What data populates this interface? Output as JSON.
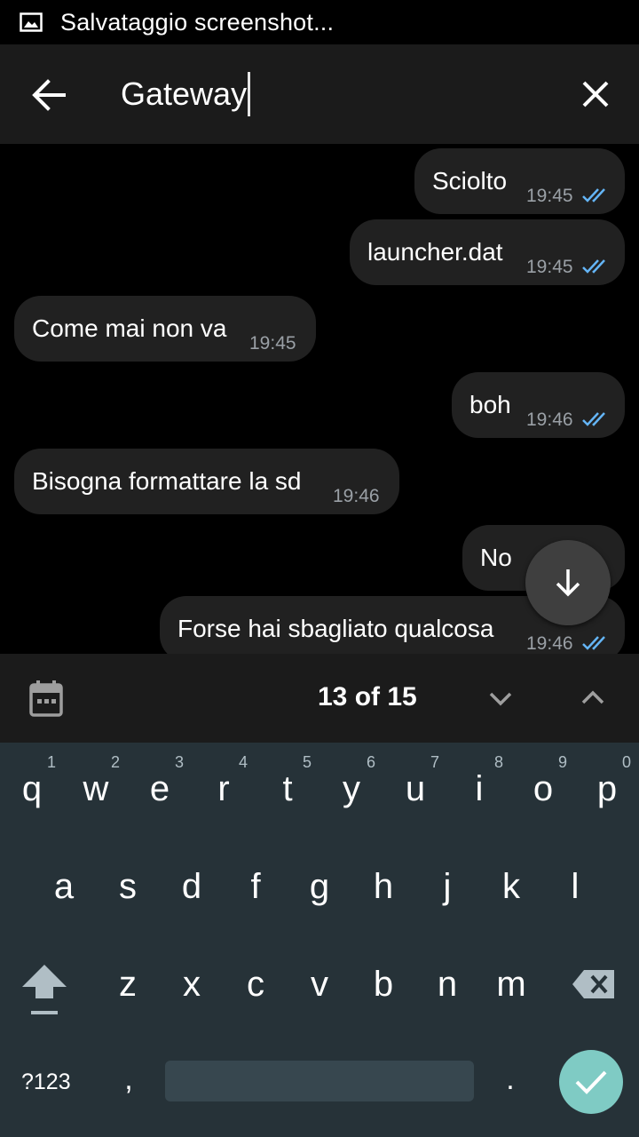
{
  "status_bar": {
    "text": "Salvataggio screenshot..."
  },
  "search": {
    "query": "Gateway"
  },
  "messages": [
    {
      "text": "Sciolto",
      "time": "19:45",
      "outgoing": true
    },
    {
      "text": "launcher.dat",
      "time": "19:45",
      "outgoing": true
    },
    {
      "text": "Come mai non va",
      "time": "19:45",
      "outgoing": false
    },
    {
      "text": "boh",
      "time": "19:46",
      "outgoing": true
    },
    {
      "text": "Bisogna formattare la sd",
      "time": "19:46",
      "outgoing": false
    },
    {
      "text": "No",
      "time": "",
      "outgoing": true
    },
    {
      "text": "Forse hai sbagliato qualcosa",
      "time": "19:46",
      "outgoing": true
    }
  ],
  "search_nav": {
    "counter": "13 of 15"
  },
  "keyboard": {
    "row1": [
      {
        "key": "q",
        "hint": "1"
      },
      {
        "key": "w",
        "hint": "2"
      },
      {
        "key": "e",
        "hint": "3"
      },
      {
        "key": "r",
        "hint": "4"
      },
      {
        "key": "t",
        "hint": "5"
      },
      {
        "key": "y",
        "hint": "6"
      },
      {
        "key": "u",
        "hint": "7"
      },
      {
        "key": "i",
        "hint": "8"
      },
      {
        "key": "o",
        "hint": "9"
      },
      {
        "key": "p",
        "hint": "0"
      }
    ],
    "row2": [
      "a",
      "s",
      "d",
      "f",
      "g",
      "h",
      "j",
      "k",
      "l"
    ],
    "row3": [
      "z",
      "x",
      "c",
      "v",
      "b",
      "n",
      "m"
    ],
    "symbols_label": "?123",
    "comma": ",",
    "period": "."
  },
  "colors": {
    "tick": "#64b5f6",
    "bubble": "#212121",
    "keyboard": "#263238",
    "enter": "#7fcbc4"
  },
  "icons": [
    "image-icon",
    "back-arrow-icon",
    "close-icon",
    "double-check-icon",
    "arrow-down-icon",
    "calendar-icon",
    "chevron-down-icon",
    "chevron-up-icon",
    "shift-icon",
    "backspace-icon",
    "check-icon"
  ]
}
